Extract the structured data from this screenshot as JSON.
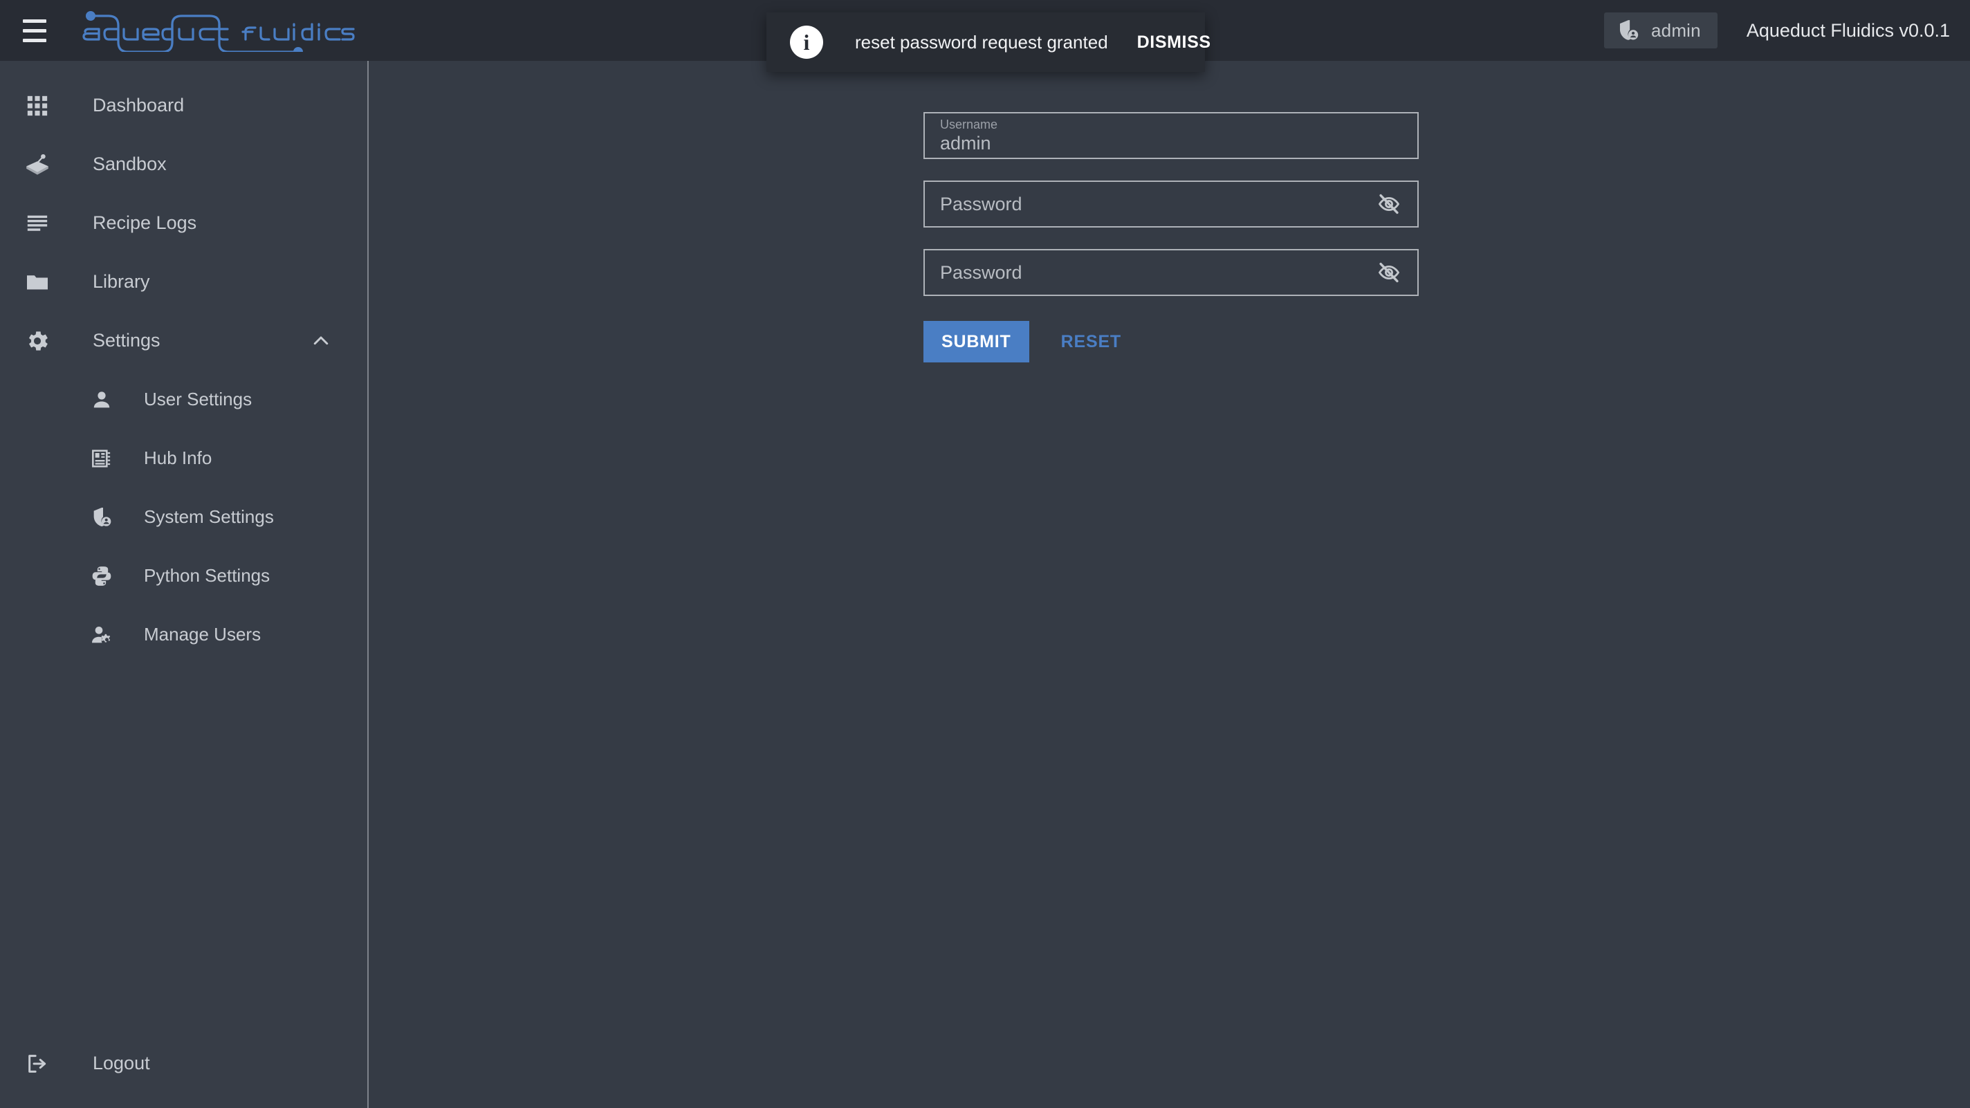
{
  "header": {
    "menu_icon": "hamburger-menu-icon",
    "logo_text": "aqueduct fluidics",
    "logo_color": "#4a7ec4",
    "user_chip": {
      "icon": "shield-account-icon",
      "label": "admin"
    },
    "version": "Aqueduct Fluidics v0.0.1"
  },
  "snackbar": {
    "icon": "info-circle-icon",
    "message": "reset password request granted",
    "action_label": "DISMISS"
  },
  "sidebar": {
    "items": [
      {
        "label": "Dashboard",
        "icon": "grid-apps-icon",
        "expandable": false
      },
      {
        "label": "Sandbox",
        "icon": "sandbox-shovel-icon",
        "expandable": false
      },
      {
        "label": "Recipe Logs",
        "icon": "log-lines-icon",
        "expandable": false
      },
      {
        "label": "Library",
        "icon": "folder-icon",
        "expandable": false
      },
      {
        "label": "Settings",
        "icon": "gear-icon",
        "expandable": true,
        "expanded": true,
        "chevron": "chevron-up-icon"
      }
    ],
    "subitems": [
      {
        "label": "User Settings",
        "icon": "person-icon"
      },
      {
        "label": "Hub Info",
        "icon": "hub-card-icon"
      },
      {
        "label": "System Settings",
        "icon": "shield-account-icon"
      },
      {
        "label": "Python Settings",
        "icon": "python-logo-icon"
      },
      {
        "label": "Manage Users",
        "icon": "person-gear-icon"
      }
    ],
    "logout": {
      "label": "Logout",
      "icon": "logout-arrow-icon"
    }
  },
  "form": {
    "username": {
      "float_label": "Username",
      "value": "admin"
    },
    "password": {
      "placeholder": "Password",
      "value": "",
      "toggle_icon": "eye-off-icon"
    },
    "password_confirm": {
      "placeholder": "Password",
      "value": "",
      "toggle_icon": "eye-off-icon"
    },
    "submit_label": "SUBMIT",
    "reset_label": "RESET"
  },
  "colors": {
    "accent": "#4a7ec4",
    "header_bg": "#282c34",
    "sidebar_bg": "#373d47",
    "content_bg": "#353b45",
    "snackbar_bg": "#282c33",
    "text_primary": "#e6e8eb",
    "text_secondary": "#c8ccd2",
    "field_border": "#aeb2b8"
  }
}
